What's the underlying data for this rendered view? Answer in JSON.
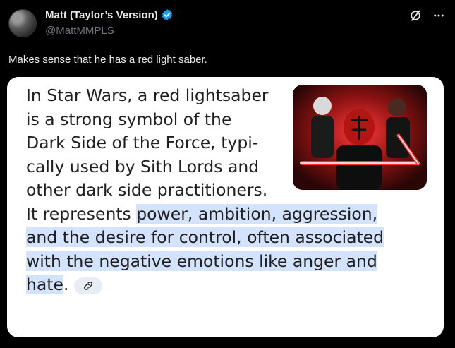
{
  "author": {
    "display_name": "Matt (Taylor’s Version)",
    "handle": "@MattMMPLS"
  },
  "tweet": {
    "text": "Makes sense that he has a red light saber."
  },
  "card": {
    "lines": [
      "In Star Wars, a red lightsaber",
      "is a strong symbol of the",
      "Dark Side of the Force, typi-",
      "cally used by Sith Lords and",
      "other dark side practitioners."
    ],
    "line6_plain": "It represents ",
    "line6_hl": "power, ambition, aggression,",
    "line7_hl": "and the desire for control, often associated",
    "line8_hl": "with the negative emotions like anger and",
    "line9_hl": "hate",
    "line9_after": "."
  },
  "icons": {
    "verified": "verified-badge-icon",
    "grok": "grok-icon",
    "more": "more-icon",
    "link": "link-icon"
  },
  "colors": {
    "background": "#000000",
    "verified": "#1d9bf0",
    "highlight": "#d3e3fd"
  }
}
